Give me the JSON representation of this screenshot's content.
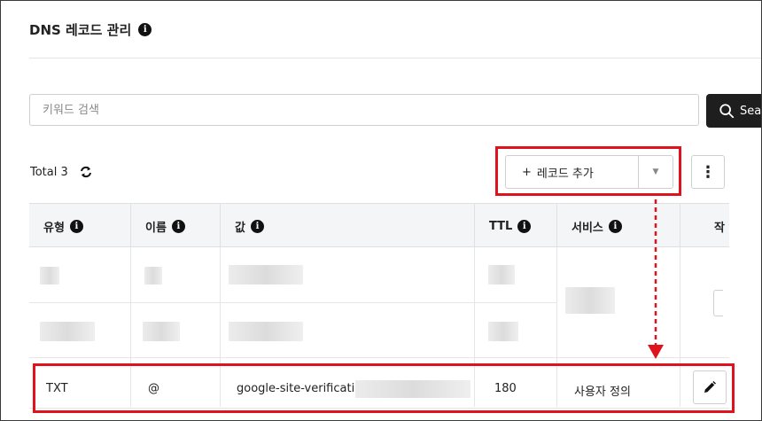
{
  "header": {
    "title": "DNS 레코드 관리",
    "info_glyph": "i"
  },
  "search": {
    "placeholder": "키워드 검색",
    "button_label": "Sea"
  },
  "summary": {
    "total_label": "Total 3"
  },
  "toolbar": {
    "add_label": "레코드 추가",
    "add_prefix": "+",
    "caret": "▼",
    "more": "⋮"
  },
  "table": {
    "columns": [
      {
        "label": "유형"
      },
      {
        "label": "이름"
      },
      {
        "label": "값"
      },
      {
        "label": "TTL"
      },
      {
        "label": "서비스"
      },
      {
        "label": "작"
      }
    ],
    "highlighted_row": {
      "type": "TXT",
      "name": "@",
      "value": "google-site-verification=",
      "ttl": "180",
      "service": "사용자 정의"
    }
  },
  "colors": {
    "highlight": "#e0121b",
    "search_button": "#1e1e1e",
    "header_bg": "#f4f5f7"
  }
}
